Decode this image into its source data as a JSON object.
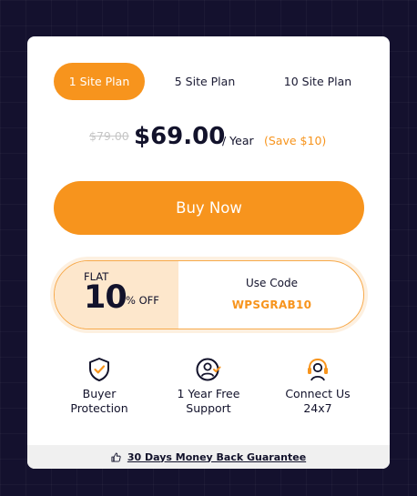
{
  "tabs": [
    {
      "label": "1 Site Plan",
      "active": true
    },
    {
      "label": "5 Site Plan",
      "active": false
    },
    {
      "label": "10 Site Plan",
      "active": false
    }
  ],
  "pricing": {
    "old_price": "$79.00",
    "price": "$69.00",
    "period": "/ Year",
    "save": "(Save $10)"
  },
  "buy_button": {
    "label": "Buy Now"
  },
  "coupon": {
    "flat": "FLAT",
    "amount": "10",
    "off": "% OFF",
    "use_code_label": "Use Code",
    "code": "WPSGRAB10"
  },
  "features": [
    {
      "icon": "shield-check-icon",
      "label_line1": "Buyer",
      "label_line2": "Protection"
    },
    {
      "icon": "user-support-icon",
      "label_line1": "1 Year Free",
      "label_line2": "Support"
    },
    {
      "icon": "headset-icon",
      "label_line1": "Connect Us",
      "label_line2": "24x7"
    }
  ],
  "guarantee": {
    "icon": "thumbs-up-icon",
    "text": "30 Days Money Back Guarantee"
  },
  "colors": {
    "accent": "#f7941d",
    "background": "#14112e",
    "card": "#ffffff",
    "text": "#12122b",
    "coupon_left_bg": "#fde7cc",
    "footer_bg": "#f0f0f0"
  }
}
